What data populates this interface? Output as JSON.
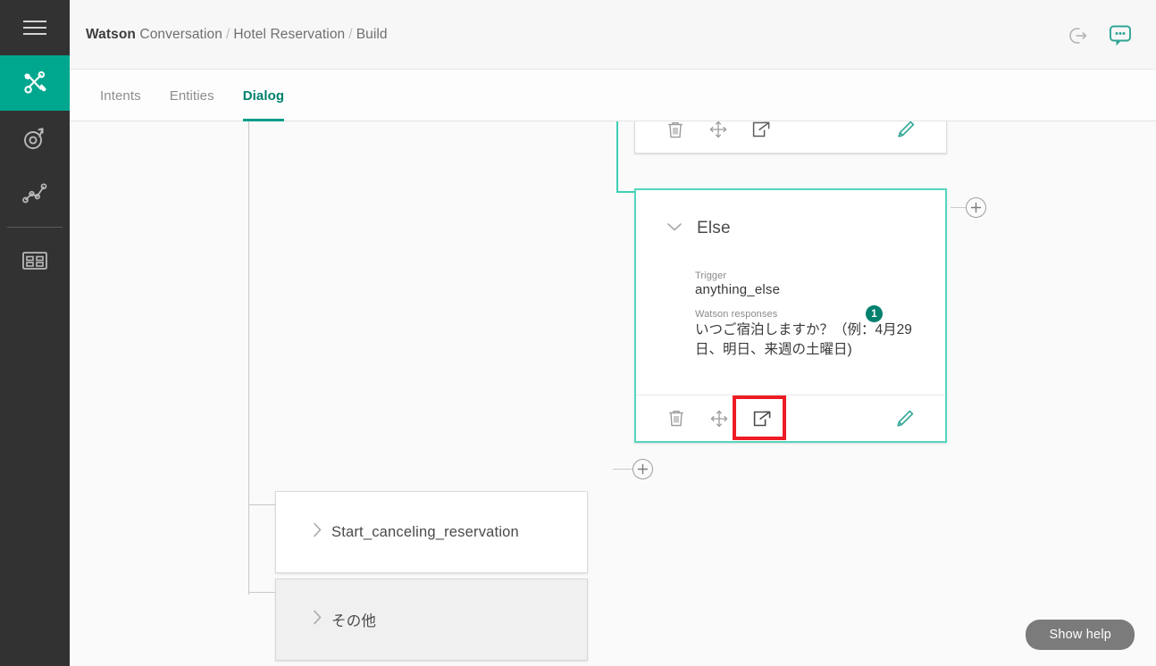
{
  "colors": {
    "rail_bg": "#323232",
    "accent_teal": "#00a78f",
    "accent_teal_dark": "#00806e",
    "node_border_selected": "#55d6bd",
    "highlight_red": "#ee1c25",
    "canvas_bg": "#fafafa"
  },
  "rail": {
    "items": [
      {
        "name": "menu-icon",
        "label": "Menu"
      },
      {
        "name": "build-tools-icon",
        "label": "Build"
      },
      {
        "name": "deploy-icon",
        "label": "Deploy"
      },
      {
        "name": "improve-icon",
        "label": "Improve"
      },
      {
        "name": "apps-grid-icon",
        "label": "Apps"
      }
    ]
  },
  "header": {
    "breadcrumb": {
      "product_bold": "Watson",
      "product_rest": " Conversation",
      "separator": "/",
      "workspace": "Hotel Reservation",
      "section": "Build"
    },
    "actions": [
      {
        "name": "logout-icon",
        "label": "Log out"
      },
      {
        "name": "chat-bubble-icon",
        "label": "Try it out"
      }
    ]
  },
  "tabs": [
    {
      "label": "Intents",
      "active": false
    },
    {
      "label": "Entities",
      "active": false
    },
    {
      "label": "Dialog",
      "active": true
    }
  ],
  "canvas": {
    "top_card": {
      "actions": [
        {
          "name": "delete-icon",
          "label": "Delete"
        },
        {
          "name": "move-icon",
          "label": "Move"
        },
        {
          "name": "jump-to-icon",
          "label": "Jump to"
        },
        {
          "name": "edit-pencil-icon",
          "label": "Edit"
        }
      ]
    },
    "else_node": {
      "chevron": "chevron-down-icon",
      "title": "Else",
      "trigger_label": "Trigger",
      "trigger_value": "anything_else",
      "responses_label": "Watson responses",
      "responses_badge": "1",
      "responses_text": "いつご宿泊しますか？（例：4月29日、明日、来週の土曜日)",
      "actions": [
        {
          "name": "delete-icon",
          "label": "Delete"
        },
        {
          "name": "move-icon",
          "label": "Move"
        },
        {
          "name": "jump-to-icon",
          "label": "Jump to",
          "highlighted": true
        },
        {
          "name": "edit-pencil-icon",
          "label": "Edit"
        }
      ]
    },
    "collapsed_nodes": [
      {
        "label": "Start_canceling_reservation",
        "hovered": false
      },
      {
        "label": "その他",
        "hovered": true
      }
    ],
    "add_buttons": [
      {
        "name": "add-node-right-button",
        "label": "+"
      },
      {
        "name": "add-node-below-button",
        "label": "+"
      }
    ]
  },
  "footer": {
    "show_help_label": "Show help"
  }
}
